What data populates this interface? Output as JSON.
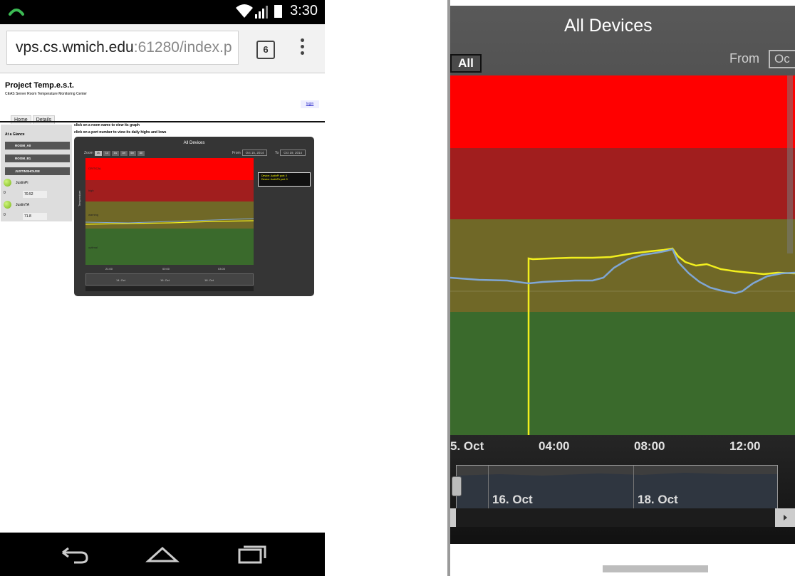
{
  "phone": {
    "status_time": "3:30",
    "url_host": "vps.cs.wmich.edu",
    "url_rest": ":61280/index.p",
    "tab_count": "6",
    "site": {
      "title": "Project Temp.e.s.t.",
      "subtitle": "CEAS Server Room Temperature Monitoring Center",
      "login": "login",
      "tabs": [
        "Home",
        "Details"
      ],
      "hint1": "click on a room name to view its graph",
      "hint2": "click on a port number to view its daily highs and lows",
      "at_a_glance": "At a Glance",
      "rooms": [
        "ROOM_A0",
        "ROOM_B1",
        "JUSTINSHOUSE"
      ],
      "devices": [
        {
          "name": "JustinPi",
          "port": "0",
          "value": "70.52"
        },
        {
          "name": "JustinTA",
          "port": "0",
          "value": "71.8"
        }
      ]
    },
    "mini_chart": {
      "title": "All Devices",
      "zoom_label": "Zoom",
      "zoom_buttons": [
        "1h",
        "1d",
        "1w",
        "1m",
        "6m",
        "All"
      ],
      "from_label": "From",
      "from_value": "Oct 15, 2014",
      "to_label": "To",
      "to_value": "Oct 19, 2014",
      "y_label": "Temperature",
      "bands": [
        "CRITICAL",
        "high",
        "warning",
        "optimal"
      ],
      "x_ticks": [
        "21:00",
        "00:00",
        "03:00"
      ],
      "nav_ticks": [
        "14. Oct",
        "16. Oct",
        "18. Oct"
      ],
      "legend": [
        "Device: JustinPi port: 0",
        "Device: JustinTA port: 0"
      ]
    }
  },
  "zoom": {
    "title": "All Devices",
    "all_button": "All",
    "from_label": "From",
    "from_value": "Oc",
    "x_ticks": [
      "5. Oct",
      "04:00",
      "08:00",
      "12:00"
    ],
    "nav_ticks": [
      "16. Oct",
      "18. Oct"
    ]
  },
  "chart_data": {
    "type": "line",
    "title": "All Devices",
    "bands": [
      {
        "name": "critical",
        "color": "#ff0000"
      },
      {
        "name": "high",
        "color": "#a11e1e"
      },
      {
        "name": "warning",
        "color": "#706827"
      },
      {
        "name": "optimal",
        "color": "#3a6a2c"
      }
    ],
    "x": [
      "5. Oct",
      "04:00",
      "08:00",
      "12:00"
    ],
    "series": [
      {
        "name": "",
        "color": "#f2ef1e"
      },
      {
        "name": "",
        "color": "#7fa6d4"
      }
    ]
  }
}
